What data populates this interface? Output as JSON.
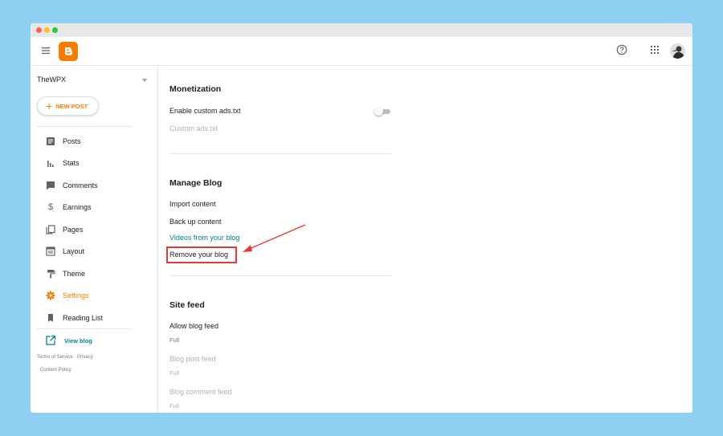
{
  "app": {
    "brand_color": "#f57d00",
    "accent_color": "#00838f",
    "highlight_color": "#e53935"
  },
  "header": {
    "menu_icon": "hamburger-menu-icon",
    "logo_icon": "blogger-logo-icon",
    "help_icon": "help-circle-icon",
    "apps_icon": "apps-grid-icon",
    "avatar_icon": "user-avatar"
  },
  "sidebar": {
    "blog_name": "TheWPX",
    "new_post_label": "NEW POST",
    "items": [
      {
        "label": "Posts",
        "icon": "posts-icon"
      },
      {
        "label": "Stats",
        "icon": "stats-icon"
      },
      {
        "label": "Comments",
        "icon": "comments-icon"
      },
      {
        "label": "Earnings",
        "icon": "dollar-icon"
      },
      {
        "label": "Pages",
        "icon": "pages-icon"
      },
      {
        "label": "Layout",
        "icon": "layout-icon"
      },
      {
        "label": "Theme",
        "icon": "paint-roller-icon"
      },
      {
        "label": "Settings",
        "icon": "gear-icon",
        "active": true
      },
      {
        "label": "Reading List",
        "icon": "bookmark-icon"
      }
    ],
    "view_blog_label": "View blog",
    "footer": {
      "terms": "Terms of Service",
      "privacy": "Privacy",
      "content_policy": "Content Policy"
    }
  },
  "main": {
    "monetization": {
      "title": "Monetization",
      "enable_ads_label": "Enable custom ads.txt",
      "enable_ads_on": false,
      "custom_ads_label": "Custom ads.txt"
    },
    "manage_blog": {
      "title": "Manage Blog",
      "import_label": "Import content",
      "backup_label": "Back up content",
      "videos_label": "Videos from your blog",
      "remove_label": "Remove your blog"
    },
    "site_feed": {
      "title": "Site feed",
      "allow_feed_label": "Allow blog feed",
      "allow_feed_value": "Full",
      "post_feed_label": "Blog post feed",
      "post_feed_value": "Full",
      "comment_feed_label": "Blog comment feed",
      "comment_feed_value": "Full"
    }
  }
}
